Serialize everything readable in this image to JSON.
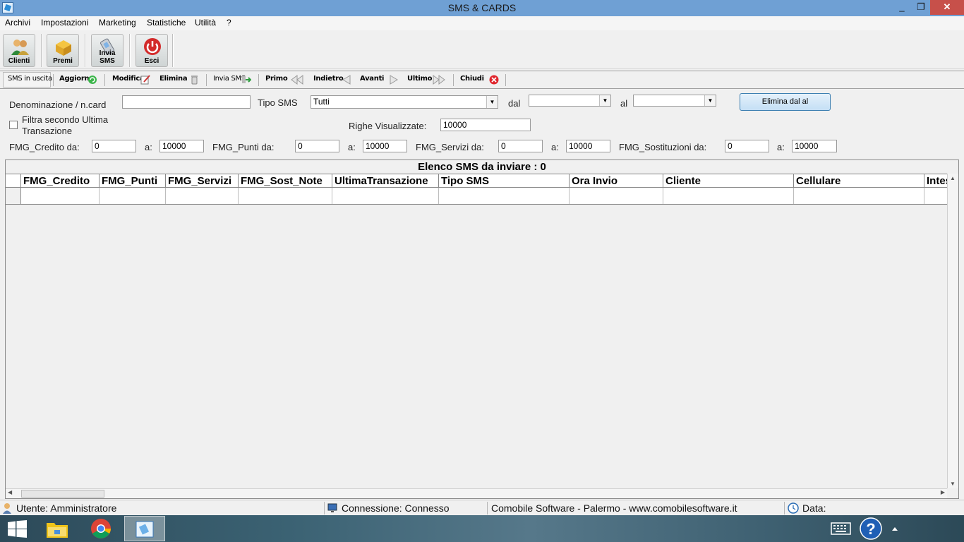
{
  "window": {
    "title": "SMS & CARDS",
    "minimize": "_",
    "maximize": "❐",
    "close": "✕"
  },
  "menu": [
    "Archivi",
    "Impostazioni",
    "Marketing",
    "Statistiche",
    "Utilità",
    "?"
  ],
  "toolbar": {
    "clienti": "Clienti",
    "premi": "Premi",
    "invia_sms": "Invia SMS",
    "esci": "Esci"
  },
  "nav": {
    "sms_uscita": "SMS in uscita",
    "aggiorna": "Aggiorna",
    "modifica": "Modifica",
    "elimina": "Elimina",
    "invia_sms": "Invia SMS",
    "primo": "Primo",
    "indietro": "Indietro",
    "avanti": "Avanti",
    "ultimo": "Ultimo",
    "chiudi": "Chiudi"
  },
  "filters": {
    "denominazione_label": "Denominazione / n.card",
    "denominazione_value": "",
    "tipo_sms_label": "Tipo SMS",
    "tipo_sms_value": "Tutti",
    "dal_label": "dal",
    "al_label": "al",
    "elimina_dal_al": "Elimina dal al",
    "filtra_label_1": "Filtra secondo Ultima",
    "filtra_label_2": "Transazione",
    "righe_label": "Righe Visualizzate:",
    "righe_value": "10000",
    "credito_label": "FMG_Credito da:",
    "credito_da": "0",
    "credito_a": "10000",
    "punti_label": "FMG_Punti da:",
    "punti_da": "0",
    "punti_a": "10000",
    "servizi_label": "FMG_Servizi da:",
    "servizi_da": "0",
    "servizi_a": "10000",
    "sostituzioni_label": "FMG_Sostituzioni da:",
    "sostituzioni_da": "0",
    "sostituzioni_a": "10000",
    "a_label": "a:"
  },
  "grid": {
    "title": "Elenco SMS da inviare : 0",
    "columns": [
      "FMG_Credito",
      "FMG_Punti",
      "FMG_Servizi",
      "FMG_Sost_Note",
      "UltimaTransazione",
      "Tipo SMS",
      "Ora Invio",
      "Cliente",
      "Cellulare",
      "Intes"
    ]
  },
  "status": {
    "utente": "Utente: Amministratore",
    "connessione": "Connessione: Connesso",
    "software": "Comobile Software - Palermo - www.comobilesoftware.it",
    "data": "Data:"
  },
  "colors": {
    "titlebar": "#6fa0d4",
    "close": "#c7504a",
    "accent": "#3c7fb1"
  }
}
